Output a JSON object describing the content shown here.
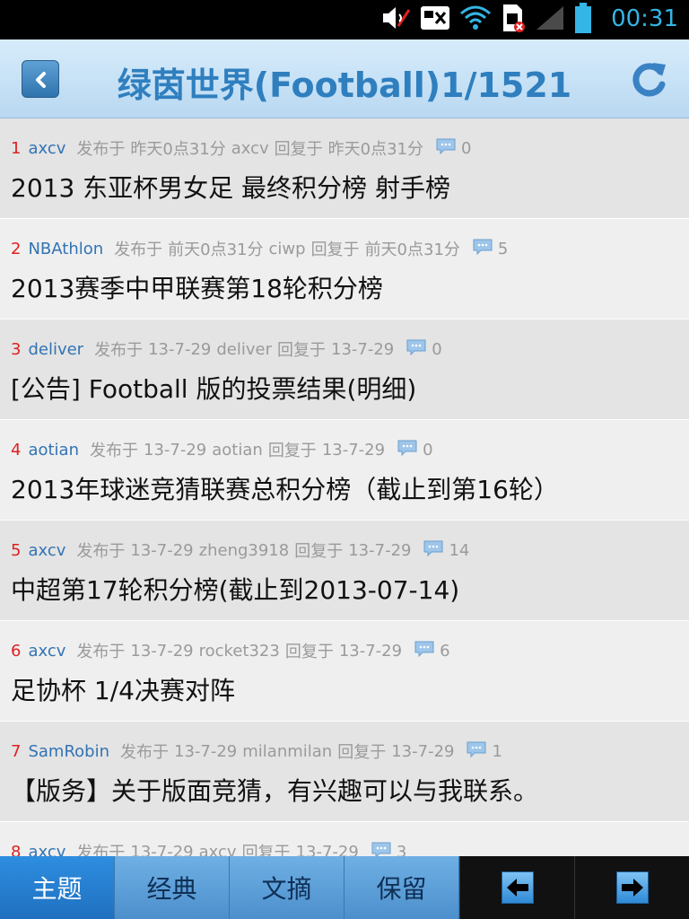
{
  "status_bar": {
    "time": "00:31",
    "icons": [
      "mute-icon",
      "no-sim-icon",
      "wifi-icon",
      "sim-error-icon",
      "signal-icon",
      "battery-icon"
    ]
  },
  "header": {
    "title": "绿茵世界(Football)1/1521",
    "back_icon": "chevron-left-icon",
    "refresh_icon": "refresh-icon"
  },
  "topics": [
    {
      "index": "1",
      "author": "axcv",
      "posted_label": "发布于",
      "posted_time": "昨天0点31分",
      "replier": "axcv",
      "reply_label": "回复于",
      "reply_time": "昨天0点31分",
      "replies": "0",
      "title": "2013 东亚杯男女足 最终积分榜 射手榜"
    },
    {
      "index": "2",
      "author": "NBAthlon",
      "posted_label": "发布于",
      "posted_time": "前天0点31分",
      "replier": "ciwp",
      "reply_label": "回复于",
      "reply_time": "前天0点31分",
      "replies": "5",
      "title": "2013赛季中甲联赛第18轮积分榜"
    },
    {
      "index": "3",
      "author": "deliver",
      "posted_label": "发布于",
      "posted_time": "13-7-29",
      "replier": "deliver",
      "reply_label": "回复于",
      "reply_time": "13-7-29",
      "replies": "0",
      "title": "[公告] Football 版的投票结果(明细)"
    },
    {
      "index": "4",
      "author": "aotian",
      "posted_label": "发布于",
      "posted_time": "13-7-29",
      "replier": "aotian",
      "reply_label": "回复于",
      "reply_time": "13-7-29",
      "replies": "0",
      "title": "2013年球迷竞猜联赛总积分榜（截止到第16轮）"
    },
    {
      "index": "5",
      "author": "axcv",
      "posted_label": "发布于",
      "posted_time": "13-7-29",
      "replier": "zheng3918",
      "reply_label": "回复于",
      "reply_time": "13-7-29",
      "replies": "14",
      "title": "中超第17轮积分榜(截止到2013-07-14)"
    },
    {
      "index": "6",
      "author": "axcv",
      "posted_label": "发布于",
      "posted_time": "13-7-29",
      "replier": "rocket323",
      "reply_label": "回复于",
      "reply_time": "13-7-29",
      "replies": "6",
      "title": "足协杯 1/4决赛对阵"
    },
    {
      "index": "7",
      "author": "SamRobin",
      "posted_label": "发布于",
      "posted_time": "13-7-29",
      "replier": "milanmilan",
      "reply_label": "回复于",
      "reply_time": "13-7-29",
      "replies": "1",
      "title": "【版务】关于版面竞猜，有兴趣可以与我联系。"
    },
    {
      "index": "8",
      "author": "axcv",
      "posted_label": "发布于",
      "posted_time": "13-7-29",
      "replier": "axcv",
      "reply_label": "回复于",
      "reply_time": "13-7-29",
      "replies": "3",
      "title": ""
    }
  ],
  "bottom_bar": {
    "tabs": [
      {
        "label": "主题",
        "active": true
      },
      {
        "label": "经典",
        "active": false
      },
      {
        "label": "文摘",
        "active": false
      },
      {
        "label": "保留",
        "active": false
      }
    ],
    "prev_icon": "arrow-left-icon",
    "next_icon": "arrow-right-icon"
  },
  "colors": {
    "accent": "#2f7fbf",
    "index_red": "#e02020",
    "author_blue": "#3273b4",
    "meta_gray": "#9a9a9a",
    "status_blue": "#33b5e5"
  }
}
